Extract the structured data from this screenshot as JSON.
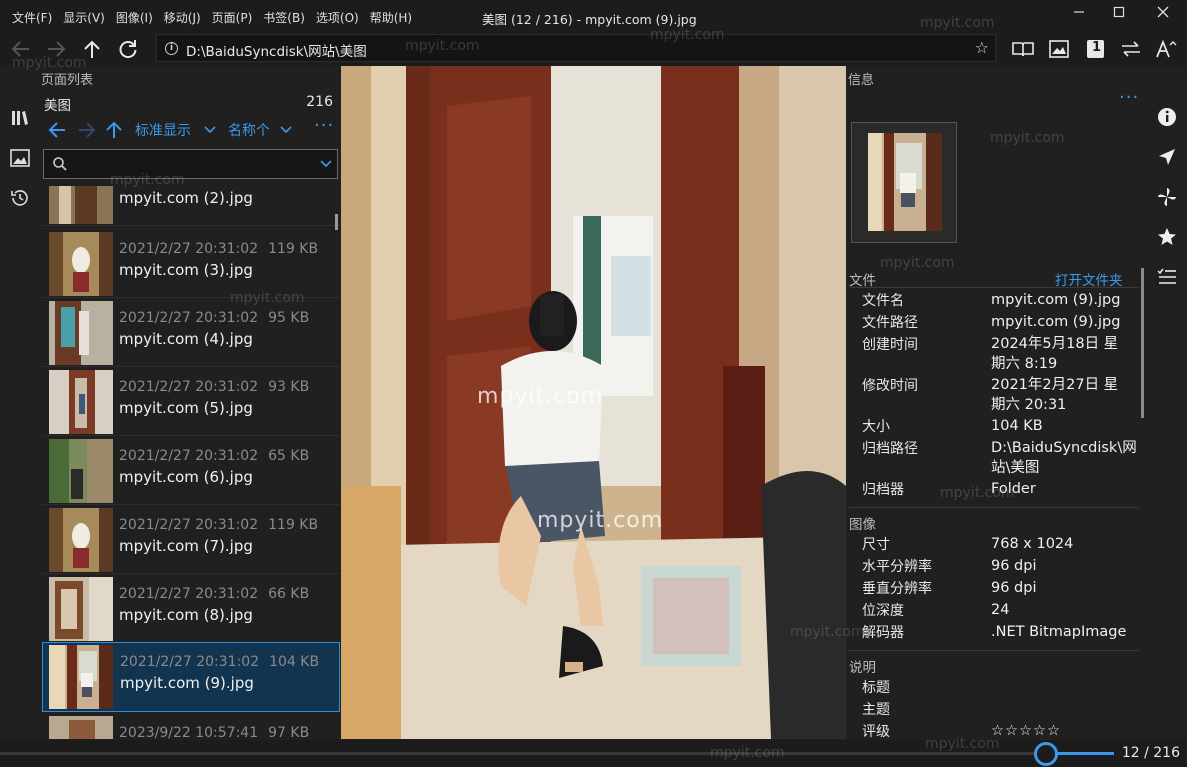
{
  "menu": [
    "文件(F)",
    "显示(V)",
    "图像(I)",
    "移动(J)",
    "页面(P)",
    "书签(B)",
    "选项(O)",
    "帮助(H)"
  ],
  "window_title": "美图 (12 / 216) - mpyit.com (9).jpg",
  "address": "D:\\BaiduSyncdisk\\网站\\美图",
  "left_panel": {
    "title": "页面列表",
    "folder": "美图",
    "count": "216",
    "view_mode": "标准显示",
    "sort": "名称个",
    "items": [
      {
        "date": "",
        "size": "",
        "name": "mpyit.com (2).jpg"
      },
      {
        "date": "2021/2/27 20:31:02",
        "size": "119 KB",
        "name": "mpyit.com (3).jpg"
      },
      {
        "date": "2021/2/27 20:31:02",
        "size": "95 KB",
        "name": "mpyit.com (4).jpg"
      },
      {
        "date": "2021/2/27 20:31:02",
        "size": "93 KB",
        "name": "mpyit.com (5).jpg"
      },
      {
        "date": "2021/2/27 20:31:02",
        "size": "65 KB",
        "name": "mpyit.com (6).jpg"
      },
      {
        "date": "2021/2/27 20:31:02",
        "size": "119 KB",
        "name": "mpyit.com (7).jpg"
      },
      {
        "date": "2021/2/27 20:31:02",
        "size": "66 KB",
        "name": "mpyit.com (8).jpg"
      },
      {
        "date": "2021/2/27 20:31:02",
        "size": "104 KB",
        "name": "mpyit.com (9).jpg"
      },
      {
        "date": "2023/9/22 10:57:41",
        "size": "97 KB",
        "name": ""
      }
    ]
  },
  "info_panel": {
    "title": "信息",
    "file_section": "文件",
    "open_folder": "打开文件夹",
    "file_rows": [
      {
        "label": "文件名",
        "value": "mpyit.com (9).jpg"
      },
      {
        "label": "文件路径",
        "value": "mpyit.com (9).jpg"
      },
      {
        "label": "创建时间",
        "value": "2024年5月18日 星期六 8:19"
      },
      {
        "label": "修改时间",
        "value": "2021年2月27日 星期六 20:31"
      },
      {
        "label": "大小",
        "value": "104 KB"
      },
      {
        "label": "归档路径",
        "value": "D:\\BaiduSyncdisk\\网站\\美图"
      },
      {
        "label": "归档器",
        "value": "Folder"
      }
    ],
    "image_section": "图像",
    "image_rows": [
      {
        "label": "尺寸",
        "value": "768 x 1024"
      },
      {
        "label": "水平分辨率",
        "value": "96 dpi"
      },
      {
        "label": "垂直分辨率",
        "value": "96 dpi"
      },
      {
        "label": "位深度",
        "value": "24"
      },
      {
        "label": "解码器",
        "value": ".NET BitmapImage"
      }
    ],
    "desc_section": "说明",
    "desc_rows": [
      {
        "label": "标题",
        "value": ""
      },
      {
        "label": "主题",
        "value": ""
      },
      {
        "label": "评级",
        "value": "☆☆☆☆☆"
      }
    ]
  },
  "toolbar": {
    "page_badge": "1"
  },
  "status": {
    "page_indicator": "12 / 216"
  },
  "watermark": "mpyit.com"
}
